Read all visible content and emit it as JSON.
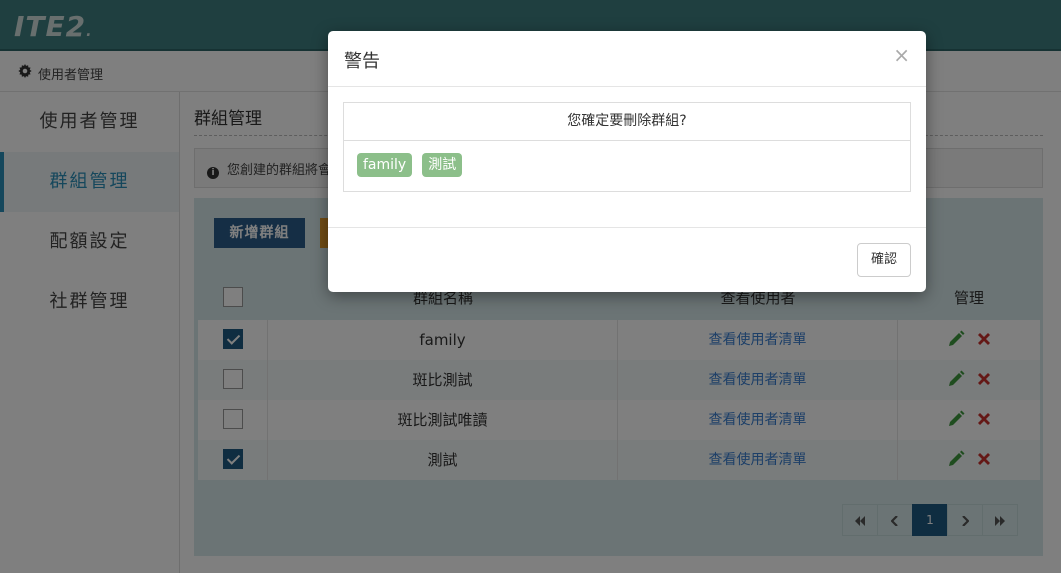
{
  "header": {
    "logo": "ITE2",
    "logo_suffix": "."
  },
  "breadcrumb": {
    "icon": "gear-icon",
    "label": "使用者管理"
  },
  "sidebar": {
    "items": [
      {
        "label": "使用者管理",
        "active": false
      },
      {
        "label": "群組管理",
        "active": true
      },
      {
        "label": "配額設定",
        "active": false
      },
      {
        "label": "社群管理",
        "active": false
      }
    ]
  },
  "main": {
    "title": "群組管理",
    "info_text": "您創建的群組將會",
    "add_group_label": "新增群組",
    "table": {
      "headers": {
        "name": "群組名稱",
        "view": "查看使用者",
        "manage": "管理"
      },
      "rows": [
        {
          "name": "family",
          "view": "查看使用者清單",
          "checked": true
        },
        {
          "name": "斑比測試",
          "view": "查看使用者清單",
          "checked": false
        },
        {
          "name": "斑比測試唯讀",
          "view": "查看使用者清單",
          "checked": false
        },
        {
          "name": "測試",
          "view": "查看使用者清單",
          "checked": true
        }
      ]
    },
    "pagination": {
      "current_page": "1"
    }
  },
  "modal": {
    "title": "警告",
    "close": "×",
    "question": "您確定要刪除群組?",
    "tags": [
      "family",
      "測試"
    ],
    "ok_label": "確認"
  },
  "colors": {
    "topbar": "#3e7f80",
    "accent": "#2a8fb9",
    "tag": "#8cbf8a",
    "primary": "#1f5b83"
  }
}
